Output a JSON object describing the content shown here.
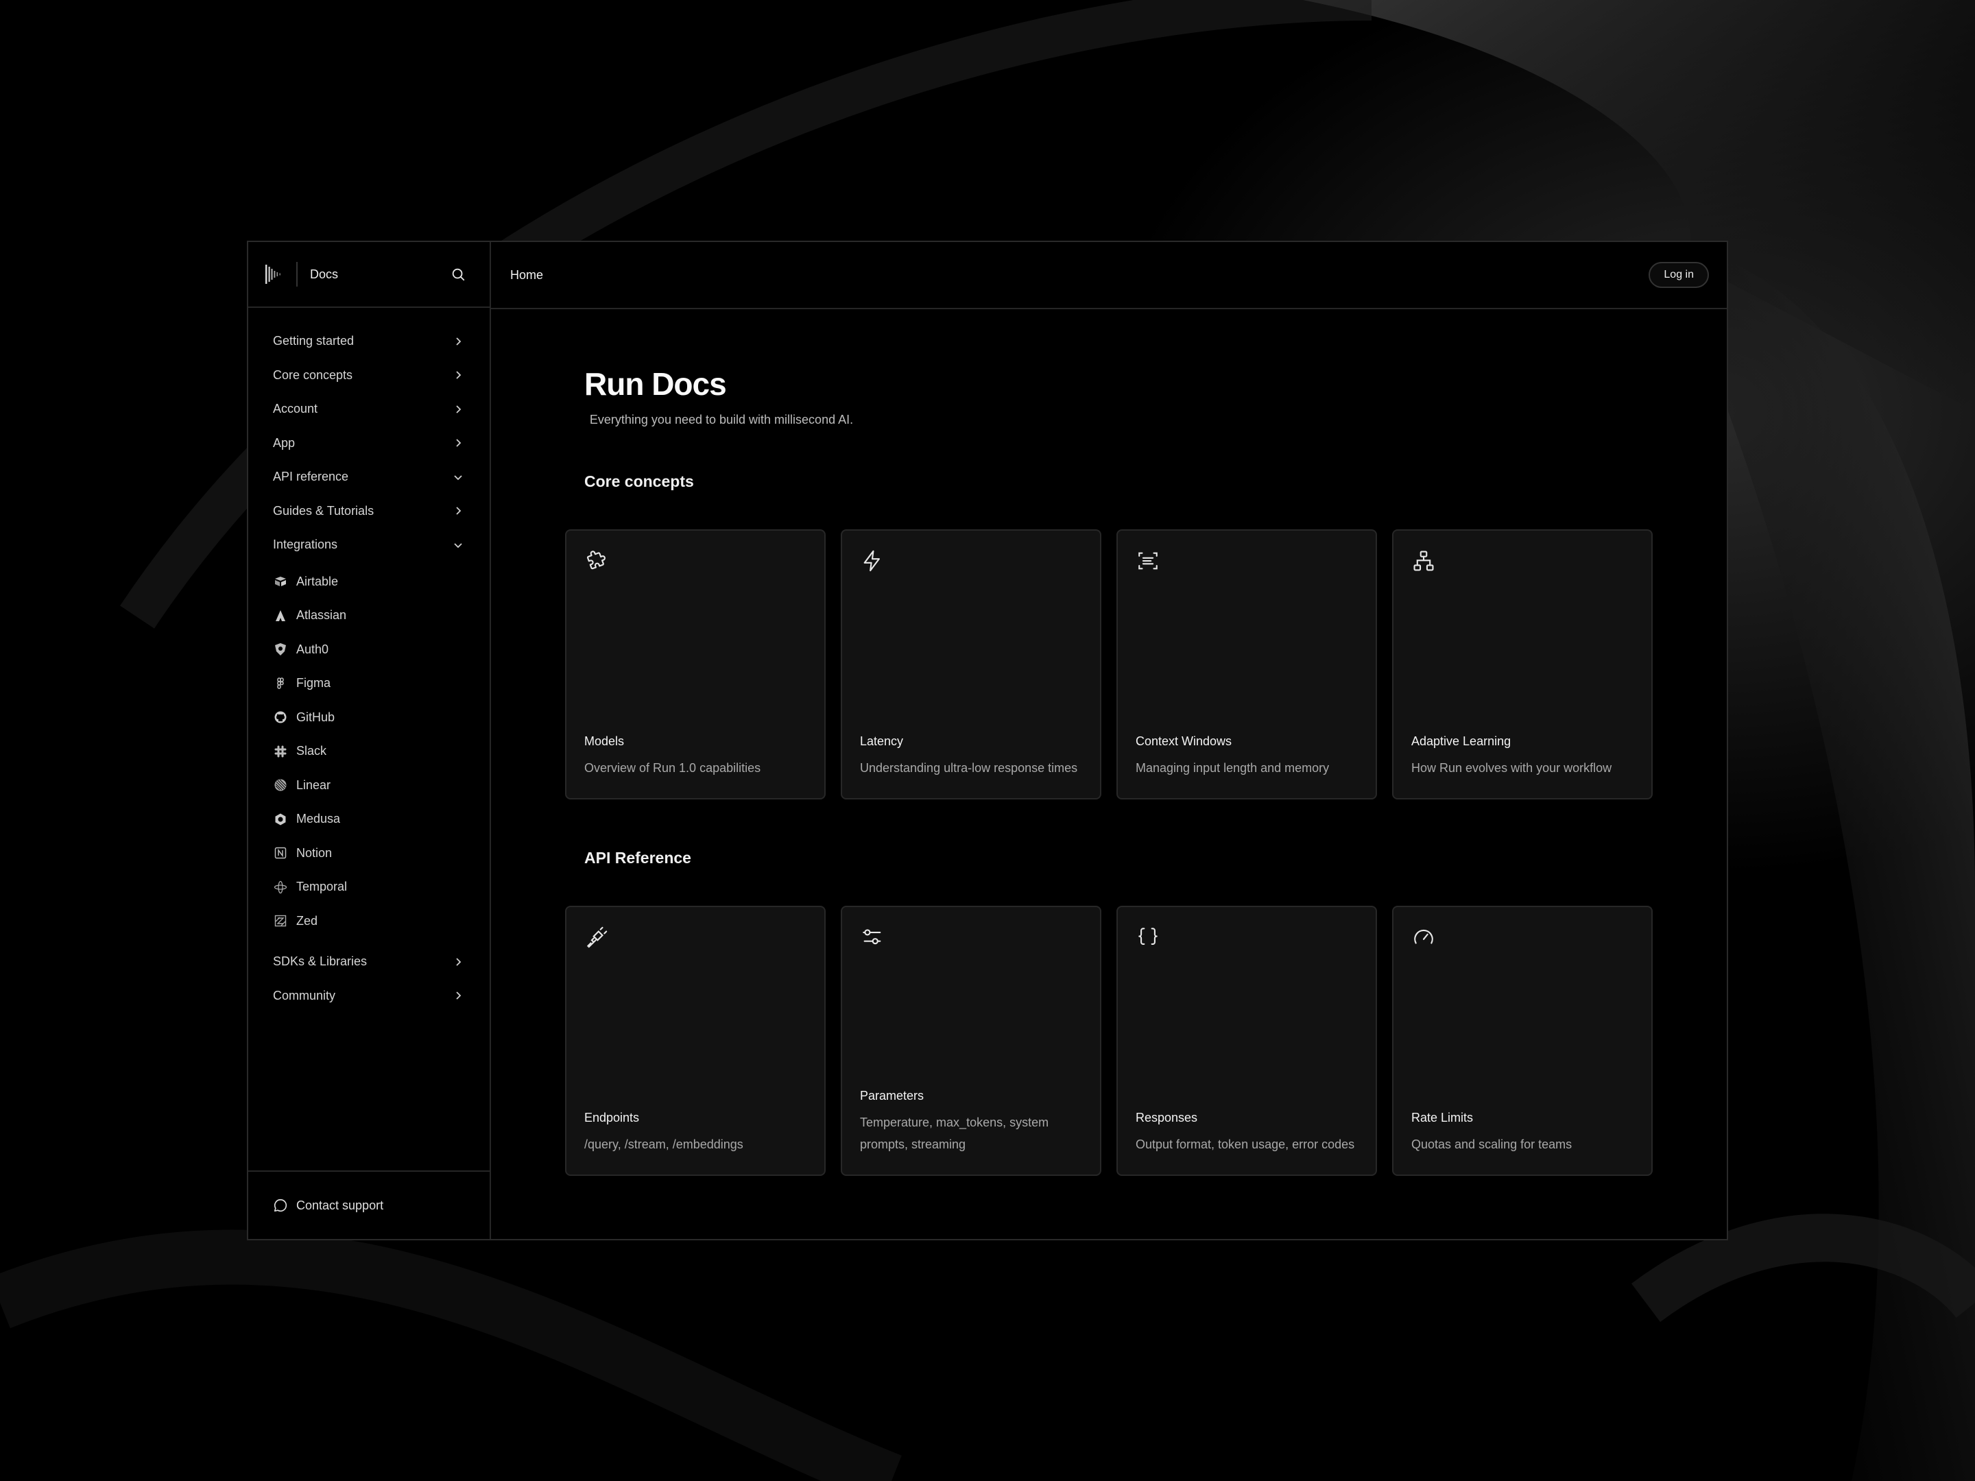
{
  "sidebar": {
    "brand": "Docs",
    "search_icon": "search-icon",
    "nav_top": [
      {
        "label": "Getting started",
        "chevron": "right"
      },
      {
        "label": "Core concepts",
        "chevron": "right"
      },
      {
        "label": "Account",
        "chevron": "right"
      },
      {
        "label": "App",
        "chevron": "right"
      },
      {
        "label": "API reference",
        "chevron": "down"
      },
      {
        "label": "Guides & Tutorials",
        "chevron": "right"
      },
      {
        "label": "Integrations",
        "chevron": "down"
      }
    ],
    "integrations": [
      {
        "label": "Airtable",
        "icon": "airtable-icon"
      },
      {
        "label": "Atlassian",
        "icon": "atlassian-icon"
      },
      {
        "label": "Auth0",
        "icon": "auth0-icon"
      },
      {
        "label": "Figma",
        "icon": "figma-icon"
      },
      {
        "label": "GitHub",
        "icon": "github-icon"
      },
      {
        "label": "Slack",
        "icon": "slack-icon"
      },
      {
        "label": "Linear",
        "icon": "linear-icon"
      },
      {
        "label": "Medusa",
        "icon": "medusa-icon"
      },
      {
        "label": "Notion",
        "icon": "notion-icon"
      },
      {
        "label": "Temporal",
        "icon": "temporal-icon"
      },
      {
        "label": "Zed",
        "icon": "zed-icon"
      }
    ],
    "nav_bottom": [
      {
        "label": "SDKs & Libraries",
        "chevron": "right"
      },
      {
        "label": "Community",
        "chevron": "right"
      }
    ],
    "support": "Contact support"
  },
  "topbar": {
    "breadcrumb": "Home",
    "login": "Log in"
  },
  "page": {
    "title": "Run Docs",
    "subtitle": "Everything you need to build with millisecond AI."
  },
  "sections": [
    {
      "title": "Core concepts",
      "cards": [
        {
          "title": "Models",
          "desc": "Overview of Run 1.0 capabilities",
          "icon": "puzzle-icon"
        },
        {
          "title": "Latency",
          "desc": "Understanding ultra-low response times",
          "icon": "lightning-icon"
        },
        {
          "title": "Context Windows",
          "desc": "Managing input length and memory",
          "icon": "text-scan-icon"
        },
        {
          "title": "Adaptive Learning",
          "desc": "How Run evolves with your workflow",
          "icon": "hierarchy-icon"
        }
      ]
    },
    {
      "title": "API Reference",
      "cards": [
        {
          "title": "Endpoints",
          "desc": "/query, /stream, /embeddings",
          "icon": "plug-icon"
        },
        {
          "title": "Parameters",
          "desc": "Temperature, max_tokens, system prompts, streaming",
          "icon": "sliders-icon"
        },
        {
          "title": "Responses",
          "desc": "Output format, token usage, error codes",
          "icon": "braces-icon"
        },
        {
          "title": "Rate Limits",
          "desc": "Quotas and scaling for teams",
          "icon": "gauge-icon"
        }
      ]
    }
  ]
}
